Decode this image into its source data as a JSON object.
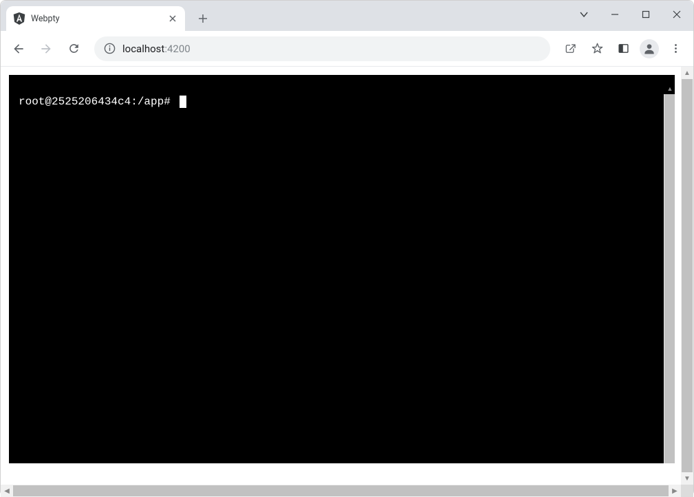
{
  "tab": {
    "title": "Webpty",
    "favicon": "angular"
  },
  "omnibox": {
    "host": "localhost",
    "port": ":4200"
  },
  "terminal": {
    "prompt": "root@2525206434c4:/app# "
  }
}
